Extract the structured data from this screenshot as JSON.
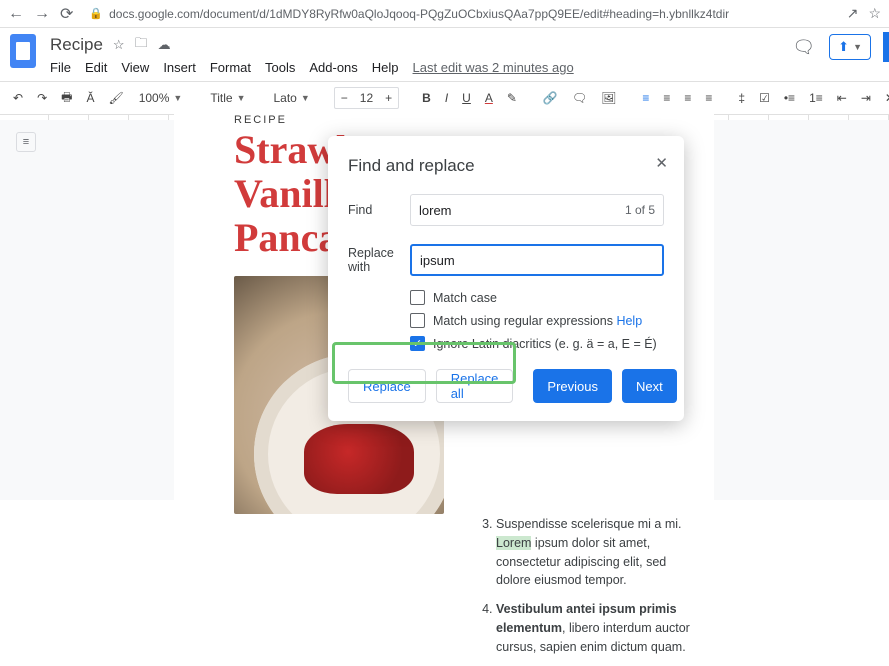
{
  "browser": {
    "url": "docs.google.com/document/d/1dMDY8RyRfw0aQloJqooq-PQgZuOCbxiusQAa7ppQ9EE/edit#heading=h.ybnllkz4tdir"
  },
  "doc": {
    "title": "Recipe",
    "last_edit": "Last edit was 2 minutes ago"
  },
  "menus": {
    "file": "File",
    "edit": "Edit",
    "view": "View",
    "insert": "Insert",
    "format": "Format",
    "tools": "Tools",
    "addons": "Add-ons",
    "help": "Help"
  },
  "toolbar": {
    "zoom": "100%",
    "style": "Title",
    "font": "Lato",
    "size": "12"
  },
  "page": {
    "label": "RECIPE",
    "title_line1": "Strawb",
    "title_line2": "Vanill",
    "title_line3": "Panca"
  },
  "body": {
    "item3_intro": "Suspendisse scelerisque mi a mi. ",
    "item3_hl": "Lorem",
    "item3_rest": " ipsum dolor sit amet, consectetur adipiscing elit, sed dolore eiusmod tempor.",
    "item4_bold": "Vestibulum antei ipsum primis elementum",
    "item4_rest": ", libero interdum auctor cursus, sapien enim dictum quam."
  },
  "dialog": {
    "title": "Find and replace",
    "find_label": "Find",
    "find_value": "lorem",
    "count": "1 of 5",
    "replace_label": "Replace with",
    "replace_value": "ipsum",
    "match_case": "Match case",
    "regex": "Match using regular expressions ",
    "help": "Help",
    "diacritics": "Ignore Latin diacritics (e. g. ä = a, E = É)",
    "btn_replace": "Replace",
    "btn_replace_all": "Replace all",
    "btn_previous": "Previous",
    "btn_next": "Next"
  }
}
